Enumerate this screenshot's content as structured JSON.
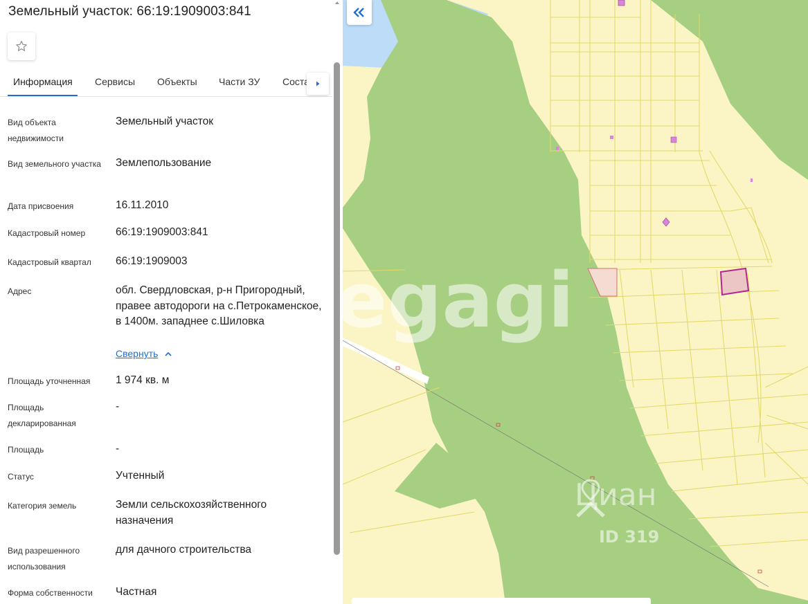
{
  "panel": {
    "title": "Земельный участок: 66:19:1909003:841",
    "favorite_icon": "star-outline-icon",
    "tabs": [
      {
        "label": "Информация",
        "active": true
      },
      {
        "label": "Сервисы",
        "active": false
      },
      {
        "label": "Объекты",
        "active": false
      },
      {
        "label": "Части ЗУ",
        "active": false
      },
      {
        "label": "Соста",
        "active": false
      }
    ],
    "tab_next_icon": "chevron-right-icon",
    "fields": [
      {
        "label": "Вид объекта недвижимости",
        "value": "Земельный участок"
      },
      {
        "label": "Вид земельного участка",
        "value": "Землепользование"
      },
      {
        "label": "Дата присвоения",
        "value": "16.11.2010"
      },
      {
        "label": "Кадастровый номер",
        "value": "66:19:1909003:841"
      },
      {
        "label": "Кадастровый квартал",
        "value": "66:19:1909003"
      },
      {
        "label": "Адрес",
        "value": "обл. Свердловская, р-н Пригородный, правее автодороги на с.Петрокаменское, в 1400м. западнее с.Шиловка"
      },
      {
        "label": "Площадь уточненная",
        "value": "1 974 кв. м"
      },
      {
        "label": "Площадь декларированная",
        "value": "-"
      },
      {
        "label": "Площадь",
        "value": "-"
      },
      {
        "label": "Статус",
        "value": "Учтенный"
      },
      {
        "label": "Категория земель",
        "value": "Земли сельскохозяйственного назначения"
      },
      {
        "label": "Вид разрешенного использования",
        "value": "для дачного строительства"
      },
      {
        "label": "Форма собственности",
        "value": "Частная"
      }
    ],
    "collapse_link": "Свернуть",
    "collapse_icon": "chevron-up-icon"
  },
  "map": {
    "collapse_panel_icon": "double-chevron-left-icon",
    "watermark_center": "egagi",
    "watermark_brand": "Циан",
    "watermark_id": "ID 319",
    "colors": {
      "parcel_fill": "#fbf5c6",
      "parcel_stroke": "#e3d96a",
      "forest": "#a6cf82",
      "water": "#bcdcf8",
      "selected_stroke": "#b0278f",
      "selected_fill": "#ecc5c5",
      "building": "#d986d9"
    }
  }
}
